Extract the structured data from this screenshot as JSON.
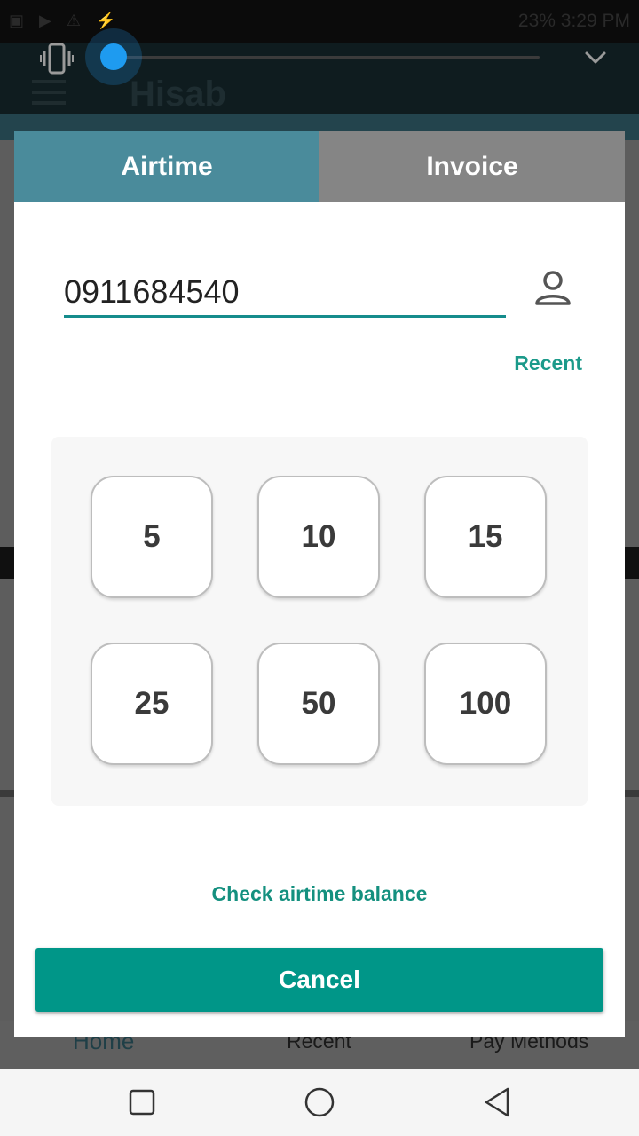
{
  "background": {
    "status_right": "23% 3:29 PM",
    "app_title": "Hisab",
    "nav": {
      "home": "Home",
      "recent": "Recent",
      "pay_methods": "Pay Methods"
    }
  },
  "volume": {
    "level": 0.0,
    "accent": "#1e9bf0"
  },
  "dialog": {
    "tabs": {
      "airtime": "Airtime",
      "invoice": "Invoice"
    },
    "phone_value": "0911684540",
    "recent_label": "Recent",
    "amounts": [
      "5",
      "10",
      "15",
      "25",
      "50",
      "100"
    ],
    "check_balance_label": "Check airtime balance",
    "cancel_label": "Cancel",
    "accent": "#009688"
  }
}
